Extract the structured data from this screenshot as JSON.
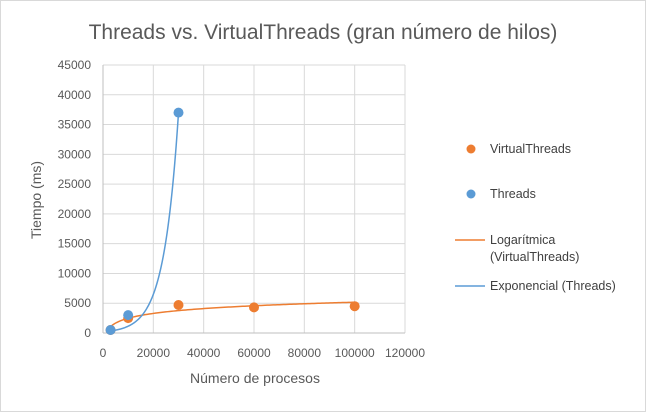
{
  "chart_data": {
    "type": "scatter",
    "title": "Threads vs. VirtualThreads (gran número de hilos)",
    "xlabel": "Número de procesos",
    "ylabel": "Tiempo (ms)",
    "xlim": [
      0,
      120000
    ],
    "ylim": [
      0,
      45000
    ],
    "x_ticks": [
      0,
      20000,
      40000,
      60000,
      80000,
      100000,
      120000
    ],
    "y_ticks": [
      0,
      5000,
      10000,
      15000,
      20000,
      25000,
      30000,
      35000,
      40000,
      45000
    ],
    "grid": true,
    "legend_position": "right",
    "series": [
      {
        "name": "VirtualThreads",
        "kind": "points",
        "color": "#ed7d31",
        "x": [
          3000,
          10000,
          30000,
          60000,
          100000
        ],
        "y": [
          500,
          2500,
          4700,
          4300,
          4500
        ]
      },
      {
        "name": "Threads",
        "kind": "points",
        "color": "#5b9bd5",
        "x": [
          3000,
          10000,
          30000
        ],
        "y": [
          500,
          3000,
          37000
        ]
      },
      {
        "name": "Logarítmica (VirtualThreads)",
        "kind": "trendline",
        "model": "logarithmic",
        "color": "#ed7d31",
        "x_range": [
          3000,
          100000
        ],
        "coef": [
          -8300,
          1170
        ]
      },
      {
        "name": "Exponencial (Threads)",
        "kind": "trendline",
        "model": "exponential",
        "color": "#5b9bd5",
        "x_range": [
          3000,
          30000
        ],
        "coef": [
          200,
          0.000174
        ]
      }
    ],
    "legend_lines": [
      [
        "VirtualThreads"
      ],
      [
        "Threads"
      ],
      [
        "Logarítmica",
        "(VirtualThreads)"
      ],
      [
        "Exponencial (Threads)"
      ]
    ]
  }
}
